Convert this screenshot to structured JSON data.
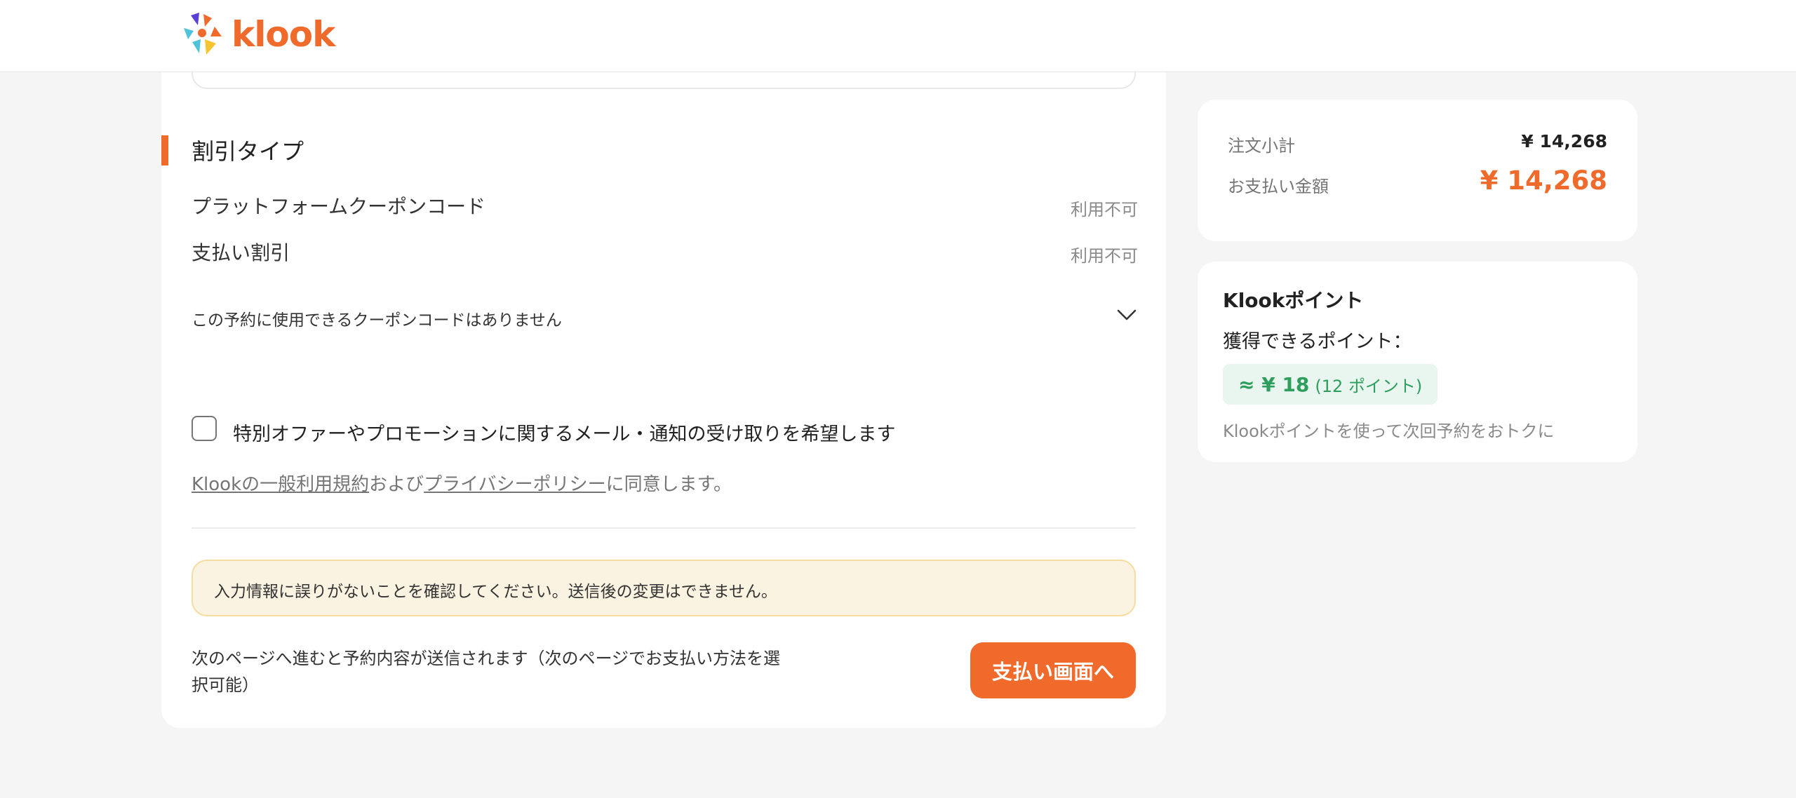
{
  "header": {
    "logo_text": "klook"
  },
  "discount": {
    "section_title": "割引タイプ",
    "rows": [
      {
        "label": "プラットフォームクーポンコード",
        "value": "利用不可"
      },
      {
        "label": "支払い割引",
        "value": "利用不可"
      }
    ],
    "coupon_note": "この予約に使用できるクーポンコードはありません"
  },
  "promo": {
    "checkbox_label": "特別オファーやプロモーションに関するメール・通知の受け取りを希望します",
    "checked": false
  },
  "terms": {
    "link1": "Klookの一般利用規約",
    "and": "および",
    "link2": "プライバシーポリシー",
    "suffix": "に同意します。"
  },
  "notice": {
    "text": "入力情報に誤りがないことを確認してください。送信後の変更はできません。"
  },
  "footer": {
    "next_text": "次のページへ進むと予約内容が送信されます（次のページでお支払い方法を選択可能）",
    "pay_button": "支払い画面へ"
  },
  "summary": {
    "subtotal_label": "注文小計",
    "subtotal_value": "¥ 14,268",
    "total_label": "お支払い金額",
    "total_value": "¥ 14,268"
  },
  "points": {
    "title": "Klookポイント",
    "subtitle": "獲得できるポイント：",
    "amount": "≈ ¥ 18",
    "count": "(12 ポイント)",
    "hint": "Klookポイントを使って次回予約をおトクに"
  },
  "colors": {
    "accent": "#f06a2b",
    "points_green": "#2e9e5c",
    "notice_bg": "#fbf3e1"
  }
}
